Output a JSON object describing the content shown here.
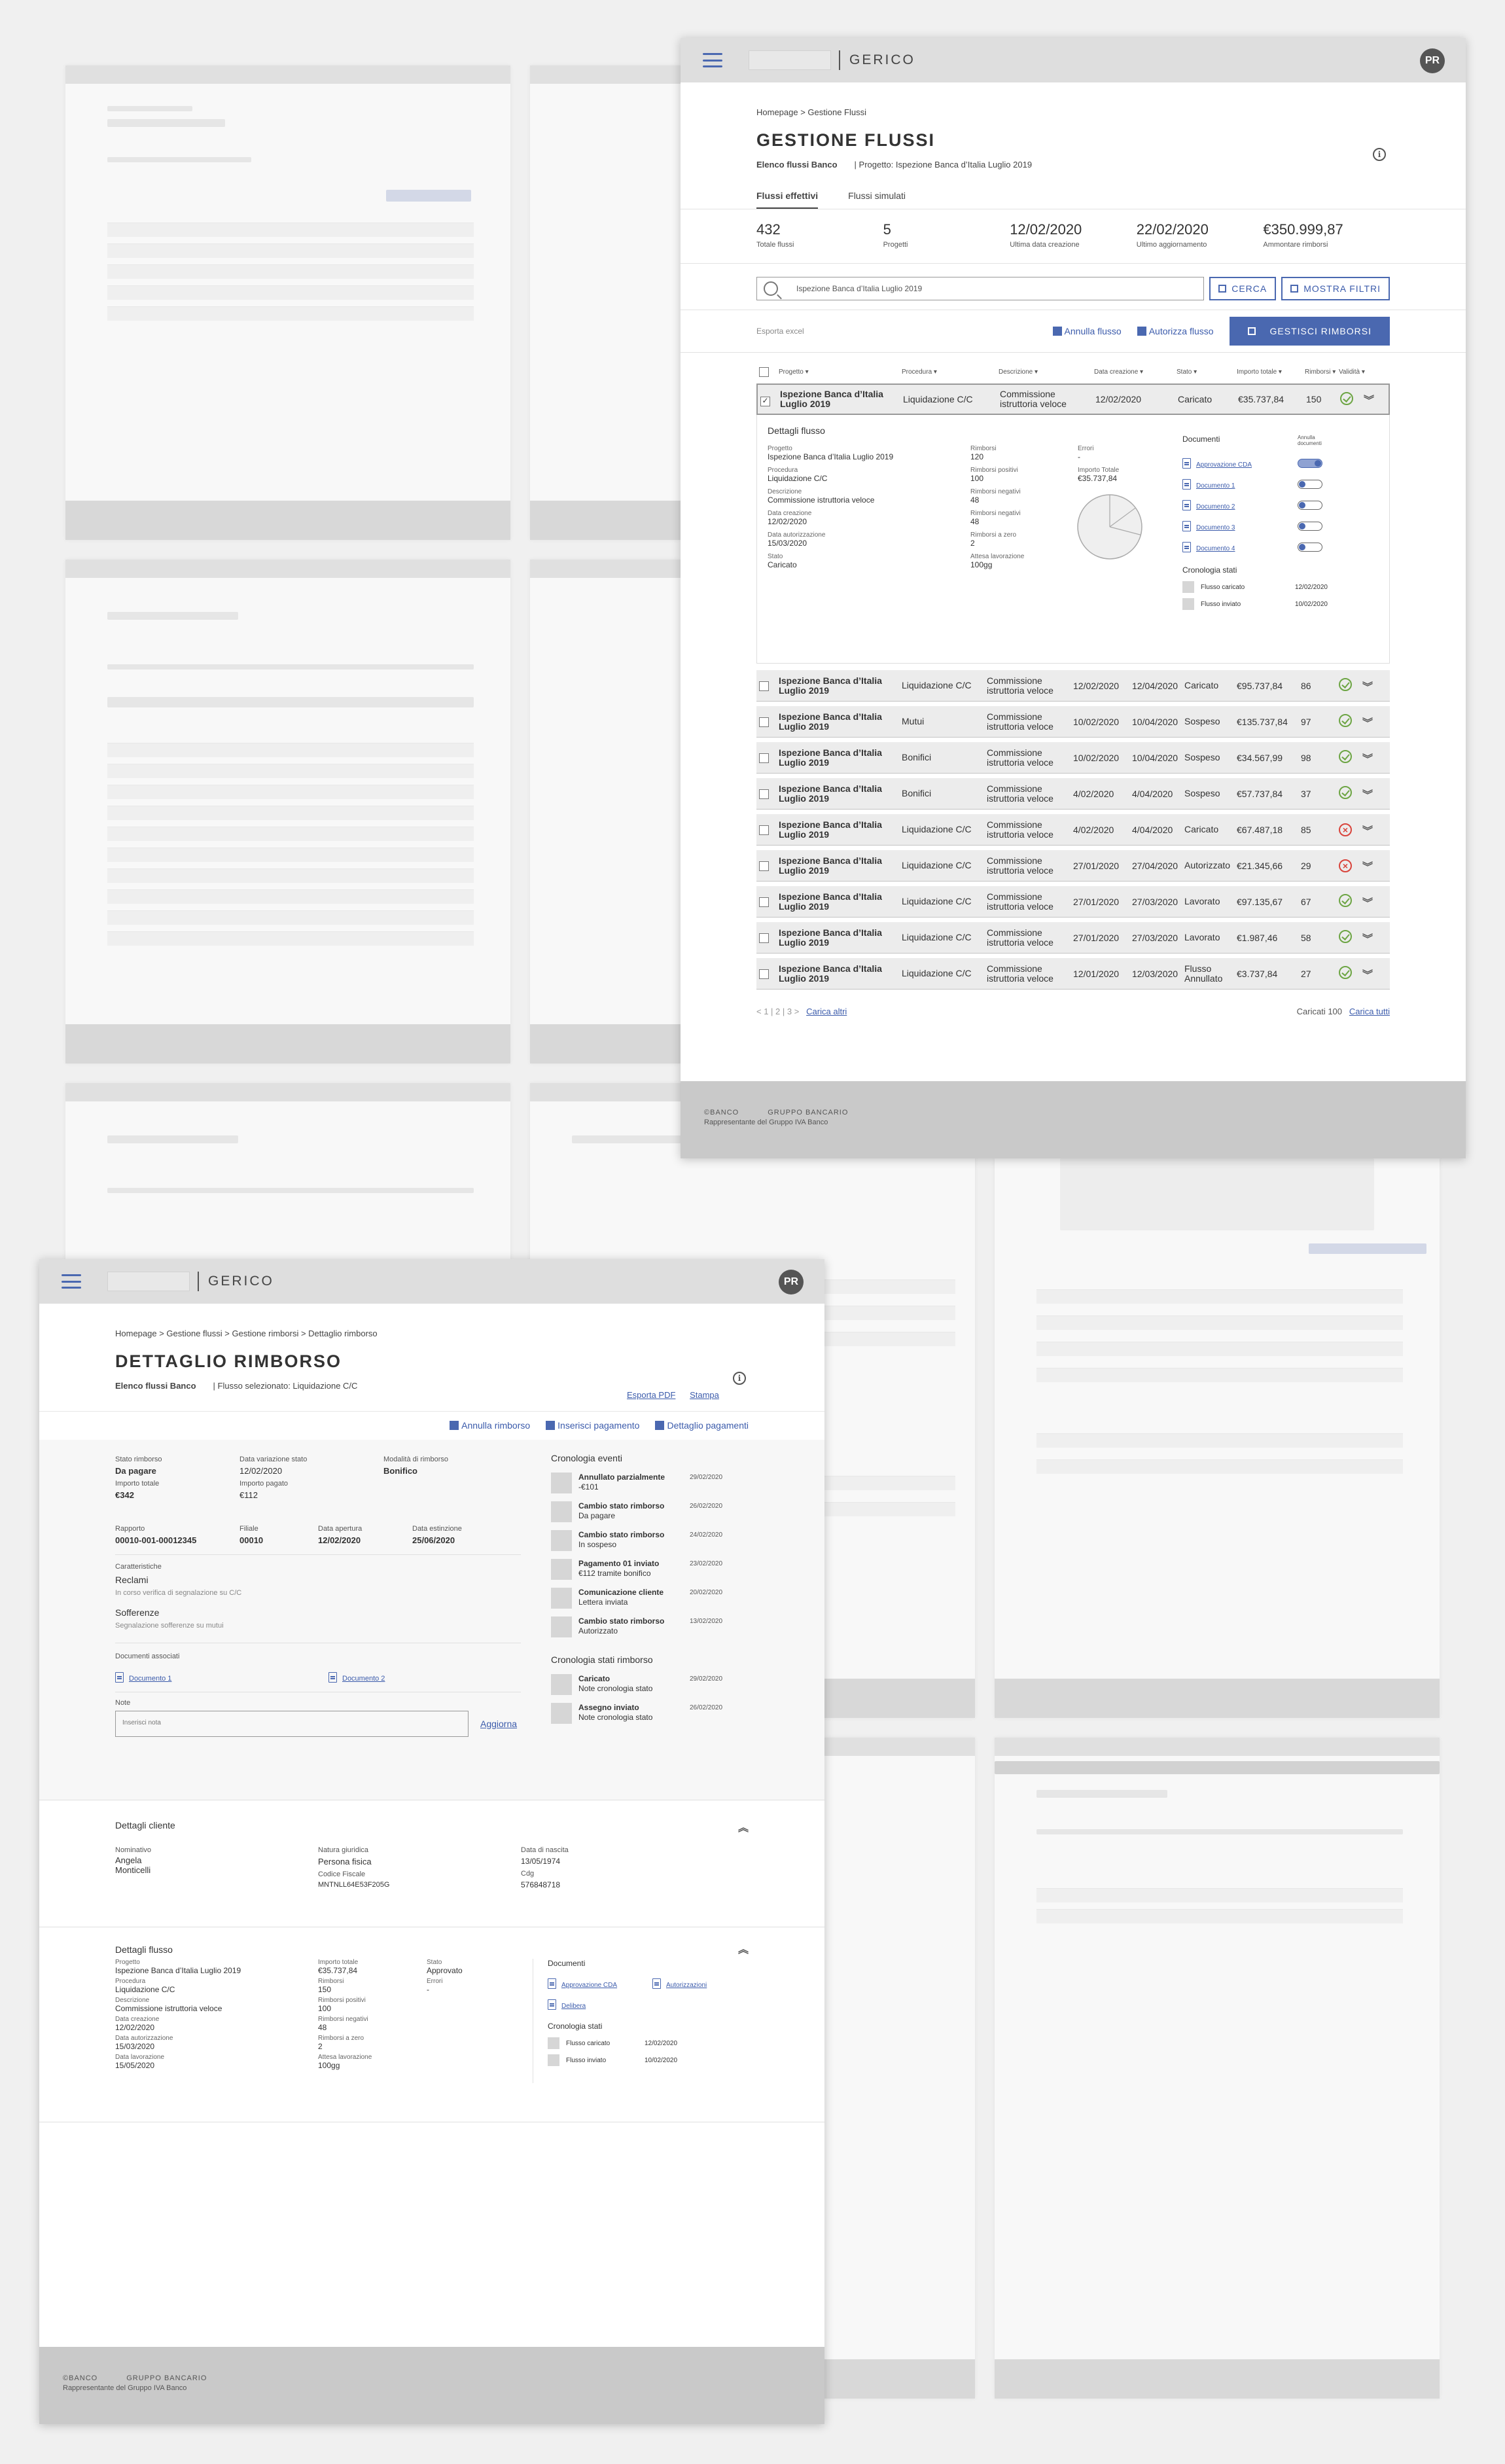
{
  "brand": "GERICO",
  "avatar_initials": "PR",
  "footer": {
    "line1a": "©BANCO",
    "line1b": "GRUPPO BANCARIO",
    "line2": "Rappresentante del Gruppo IVA Banco"
  },
  "gestione": {
    "breadcrumb": "Homepage > Gestione Flussi",
    "title": "GESTIONE FLUSSI",
    "sub_left": "Elenco flussi Banco",
    "sub_right": "| Progetto: Ispezione Banca d’Italia Luglio 2019",
    "tabs": [
      "Flussi effettivi",
      "Flussi simulati"
    ],
    "stats": [
      {
        "value": "432",
        "label": "Totale flussi"
      },
      {
        "value": "5",
        "label": "Progetti"
      },
      {
        "value": "12/02/2020",
        "label": "Ultima data creazione"
      },
      {
        "value": "22/02/2020",
        "label": "Ultimo aggiornamento"
      },
      {
        "value": "€350.999,87",
        "label": "Ammontare rimborsi"
      }
    ],
    "search_value": "Ispezione Banca d’Italia Luglio 2019",
    "search_button": "CERCA",
    "filters_button": "MOSTRA FILTRI",
    "export_label": "Esporta excel",
    "annulla_label": "Annulla flusso",
    "autorizza_label": "Autorizza flusso",
    "gestisci_label": "GESTISCI RIMBORSI",
    "columns": [
      "Progetto ▾",
      "Procedura ▾",
      "Descrizione ▾",
      "Data creazione ▾",
      "Stato ▾",
      "Importo totale ▾",
      "Rimborsi ▾",
      "Validità ▾"
    ],
    "first_row": {
      "prog": "Ispezione Banca d’Italia Luglio 2019",
      "proc": "Liquidazione C/C",
      "desc": "Commissione istruttoria veloce",
      "dc": "12/02/2020",
      "st": "Caricato",
      "imp": "€35.737,84",
      "rim": "150"
    },
    "detail": {
      "title": "Dettagli flusso",
      "col1": [
        {
          "l": "Progetto",
          "v": "Ispezione Banca d’Italia Luglio 2019"
        },
        {
          "l": "Procedura",
          "v": "Liquidazione C/C"
        },
        {
          "l": "Descrizione",
          "v": "Commissione istruttoria veloce"
        },
        {
          "l": "Data creazione",
          "v": "12/02/2020"
        },
        {
          "l": "Data autorizzazione",
          "v": "15/03/2020"
        },
        {
          "l": "Stato",
          "v": "Caricato"
        }
      ],
      "col2": [
        {
          "l": "Rimborsi",
          "v": "120"
        },
        {
          "l": "Rimborsi positivi",
          "v": "100"
        },
        {
          "l": "Rimborsi negativi",
          "v": "48"
        },
        {
          "l": "Rimborsi negativi",
          "v": "48"
        },
        {
          "l": "Rimborsi a zero",
          "v": "2"
        },
        {
          "l": "Attesa lavorazione",
          "v": "100gg"
        }
      ],
      "col3": [
        {
          "l": "Errori",
          "v": "-"
        },
        {
          "l": "Importo Totale",
          "v": "€35.737,84"
        }
      ],
      "docs_title": "Documenti",
      "docs_toggle_label": "Annulla documenti",
      "docs": [
        "Approvazione CDA",
        "Documento 1",
        "Documento 2",
        "Documento 3",
        "Documento 4"
      ],
      "chron_title": "Cronologia stati",
      "chron": [
        {
          "l": "Flusso caricato",
          "d": "12/02/2020"
        },
        {
          "l": "Flusso inviato",
          "d": "10/02/2020"
        }
      ]
    },
    "rows": [
      {
        "prog": "Ispezione Banca d’Italia Luglio 2019",
        "proc": "Liquidazione C/C",
        "desc": "Commissione istruttoria veloce",
        "dc": "12/02/2020",
        "da": "12/04/2020",
        "st": "Caricato",
        "imp": "€95.737,84",
        "rim": "86",
        "ok": true
      },
      {
        "prog": "Ispezione Banca d’Italia Luglio 2019",
        "proc": "Mutui",
        "desc": "Commissione istruttoria veloce",
        "dc": "10/02/2020",
        "da": "10/04/2020",
        "st": "Sospeso",
        "imp": "€135.737,84",
        "rim": "97",
        "ok": true
      },
      {
        "prog": "Ispezione Banca d’Italia Luglio 2019",
        "proc": "Bonifici",
        "desc": "Commissione istruttoria veloce",
        "dc": "10/02/2020",
        "da": "10/04/2020",
        "st": "Sospeso",
        "imp": "€34.567,99",
        "rim": "98",
        "ok": true
      },
      {
        "prog": "Ispezione Banca d’Italia Luglio 2019",
        "proc": "Bonifici",
        "desc": "Commissione istruttoria veloce",
        "dc": "4/02/2020",
        "da": "4/04/2020",
        "st": "Sospeso",
        "imp": "€57.737,84",
        "rim": "37",
        "ok": true
      },
      {
        "prog": "Ispezione Banca d’Italia Luglio 2019",
        "proc": "Liquidazione C/C",
        "desc": "Commissione istruttoria veloce",
        "dc": "4/02/2020",
        "da": "4/04/2020",
        "st": "Caricato",
        "imp": "€67.487,18",
        "rim": "85",
        "ok": false
      },
      {
        "prog": "Ispezione Banca d’Italia Luglio 2019",
        "proc": "Liquidazione C/C",
        "desc": "Commissione istruttoria veloce",
        "dc": "27/01/2020",
        "da": "27/04/2020",
        "st": "Autorizzato",
        "imp": "€21.345,66",
        "rim": "29",
        "ok": false
      },
      {
        "prog": "Ispezione Banca d’Italia Luglio 2019",
        "proc": "Liquidazione C/C",
        "desc": "Commissione istruttoria veloce",
        "dc": "27/01/2020",
        "da": "27/03/2020",
        "st": "Lavorato",
        "imp": "€97.135,67",
        "rim": "67",
        "ok": true
      },
      {
        "prog": "Ispezione Banca d’Italia Luglio 2019",
        "proc": "Liquidazione C/C",
        "desc": "Commissione istruttoria veloce",
        "dc": "27/01/2020",
        "da": "27/03/2020",
        "st": "Lavorato",
        "imp": "€1.987,46",
        "rim": "58",
        "ok": true
      },
      {
        "prog": "Ispezione Banca d’Italia Luglio 2019",
        "proc": "Liquidazione C/C",
        "desc": "Commissione istruttoria veloce",
        "dc": "12/01/2020",
        "da": "12/03/2020",
        "st": "Flusso Annullato",
        "imp": "€3.737,84",
        "rim": "27",
        "ok": true
      }
    ],
    "pager": "< 1 | 2 | 3 >",
    "load_more": "Carica altri",
    "loaded": "Caricati 100",
    "load_all": "Carica tutti"
  },
  "dettaglio": {
    "breadcrumb": "Homepage > Gestione flussi > Gestione rimborsi > Dettaglio rimborso",
    "title": "DETTAGLIO RIMBORSO",
    "sub_left": "Elenco flussi Banco",
    "sub_right": "| Flusso selezionato: Liquidazione C/C",
    "export_pdf": "Esporta PDF",
    "print": "Stampa",
    "actions": [
      "Annulla rimborso",
      "Inserisci pagamento",
      "Dettaglio pagamenti"
    ],
    "stato": {
      "l": "Stato rimborso",
      "v": "Da pagare"
    },
    "data_var": {
      "l": "Data variazione stato",
      "v": "12/02/2020"
    },
    "modalita": {
      "l": "Modalità di rimborso",
      "v": "Bonifico"
    },
    "importo_tot": {
      "l": "Importo totale",
      "v": "€342"
    },
    "importo_pag": {
      "l": "Importo pagato",
      "v": "€112"
    },
    "rapporto": {
      "l": "Rapporto",
      "v": "00010-001-00012345"
    },
    "filiale": {
      "l": "Filiale",
      "v": "00010"
    },
    "data_ap": {
      "l": "Data apertura",
      "v": "12/02/2020"
    },
    "data_est": {
      "l": "Data estinzione",
      "v": "25/06/2020"
    },
    "caratteristiche": "Caratteristiche",
    "reclami": "Reclami",
    "reclami_v": "In corso verifica di segnalazione su C/C",
    "sofferenze": "Sofferenze",
    "sofferenze_v": "Segnalazione sofferenze su mutui",
    "docs_title": "Documenti associati",
    "docs": [
      "Documento 1",
      "Documento 2"
    ],
    "note_label": "Note",
    "note_placeholder": "Inserisci nota",
    "update": "Aggiorna",
    "events_title": "Cronologia eventi",
    "events": [
      {
        "t": "Annullato parzialmente",
        "s": "-€101",
        "d": "29/02/2020"
      },
      {
        "t": "Cambio stato rimborso",
        "s": "Da pagare",
        "d": "26/02/2020"
      },
      {
        "t": "Cambio stato rimborso",
        "s": "In sospeso",
        "d": "24/02/2020"
      },
      {
        "t": "Pagamento 01 inviato",
        "s": "€112 tramite bonifico",
        "d": "23/02/2020"
      },
      {
        "t": "Comunicazione cliente",
        "s": "Lettera inviata",
        "d": "20/02/2020"
      },
      {
        "t": "Cambio stato rimborso",
        "s": "Autorizzato",
        "d": "13/02/2020"
      }
    ],
    "states_title": "Cronologia stati rimborso",
    "states": [
      {
        "t": "Caricato",
        "s": "Note cronologia stato",
        "d": "29/02/2020"
      },
      {
        "t": "Assegno inviato",
        "s": "Note cronologia stato",
        "d": "26/02/2020"
      }
    ],
    "cliente": {
      "title": "Dettagli cliente",
      "nominativo": {
        "l": "Nominativo",
        "v": "Angela Monticelli"
      },
      "natura": {
        "l": "Natura giuridica",
        "v": "Persona fisica"
      },
      "cf": {
        "l": "Codice Fiscale",
        "v": "MNTNLL64E53F205G"
      },
      "nascita": {
        "l": "Data di nascita",
        "v": "13/05/1974"
      },
      "cdg": {
        "l": "Cdg",
        "v": "576848718"
      }
    },
    "flusso": {
      "title": "Dettagli flusso",
      "col1": [
        {
          "l": "Progetto",
          "v": "Ispezione Banca d’Italia Luglio 2019"
        },
        {
          "l": "Procedura",
          "v": "Liquidazione C/C"
        },
        {
          "l": "Descrizione",
          "v": "Commissione istruttoria veloce"
        },
        {
          "l": "Data creazione",
          "v": "12/02/2020"
        },
        {
          "l": "Data autorizzazione",
          "v": "15/03/2020"
        },
        {
          "l": "Data lavorazione",
          "v": "15/05/2020"
        }
      ],
      "col2": [
        {
          "l": "Importo totale",
          "v": "€35.737,84"
        },
        {
          "l": "Rimborsi",
          "v": "150"
        },
        {
          "l": "Rimborsi positivi",
          "v": "100"
        },
        {
          "l": "Rimborsi negativi",
          "v": "48"
        },
        {
          "l": "Rimborsi a zero",
          "v": "2"
        },
        {
          "l": "Attesa lavorazione",
          "v": "100gg"
        }
      ],
      "col3": [
        {
          "l": "Stato",
          "v": "Approvato"
        },
        {
          "l": "Errori",
          "v": "-"
        }
      ],
      "docs_title": "Documenti",
      "docs": [
        "Approvazione CDA",
        "Autorizzazioni",
        "Delibera"
      ],
      "chron_title": "Cronologia stati",
      "chron": [
        {
          "l": "Flusso caricato",
          "d": "12/02/2020"
        },
        {
          "l": "Flusso inviato",
          "d": "10/02/2020"
        }
      ]
    }
  }
}
